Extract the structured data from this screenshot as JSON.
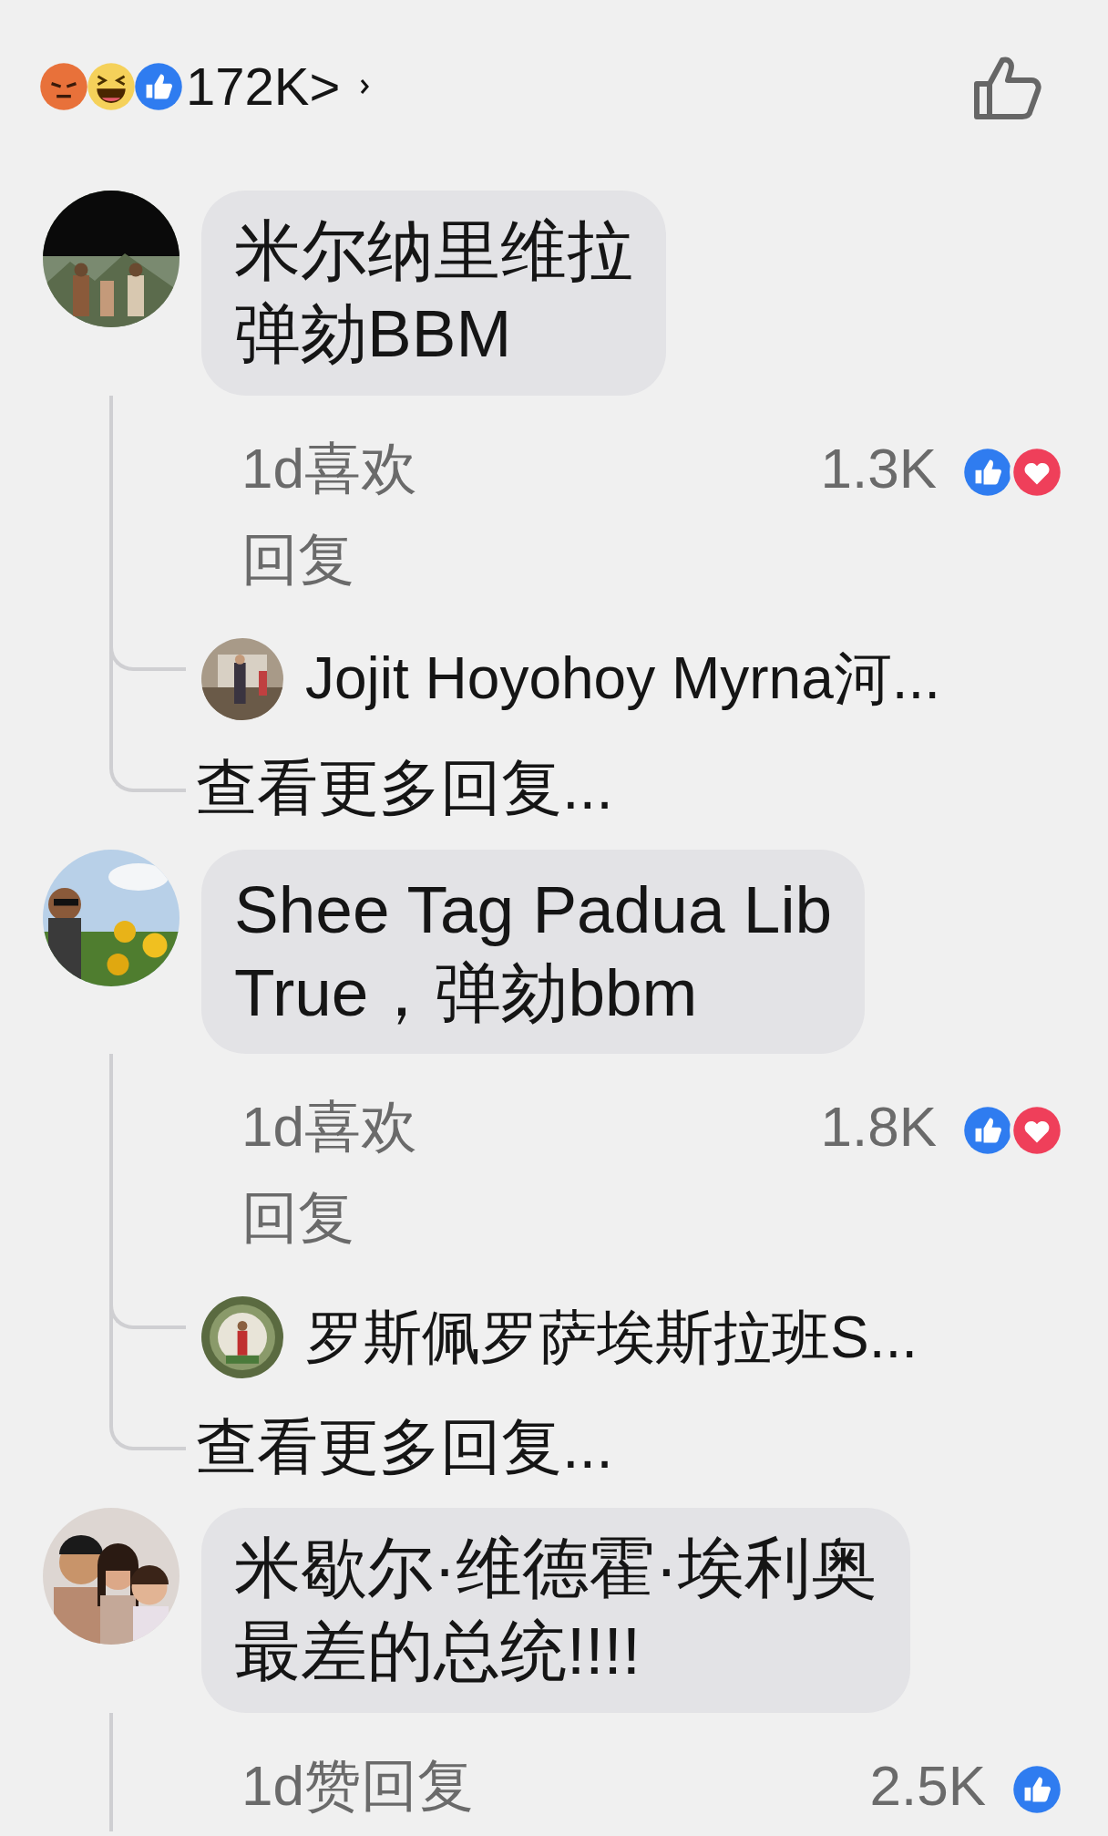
{
  "reactions_bar": {
    "reactions": [
      {
        "kind": "angry"
      },
      {
        "kind": "haha"
      },
      {
        "kind": "like"
      }
    ],
    "count": "172K>"
  },
  "comments": [
    {
      "lines": [
        "米尔纳里维拉",
        "弹劾BBM"
      ],
      "time": "1d",
      "like": "喜欢",
      "reply": "回复",
      "count": "1.3K",
      "reactions": [
        {
          "kind": "like"
        },
        {
          "kind": "love"
        }
      ],
      "reply_preview": {
        "text": "Jojit Hoyohoy Myrna河..."
      },
      "more_replies": "查看更多回复..."
    },
    {
      "lines": [
        "Shee Tag Padua Lib",
        "True，弹劾bbm"
      ],
      "time": "1d",
      "like": "喜欢",
      "reply": "回复",
      "count": "1.8K",
      "reactions": [
        {
          "kind": "like"
        },
        {
          "kind": "love"
        }
      ],
      "reply_preview": {
        "text": "罗斯佩罗萨埃斯拉班S..."
      },
      "more_replies": "查看更多回复..."
    },
    {
      "lines": [
        "米歇尔·维德霍·埃利奥",
        "最差的总统!!!!"
      ],
      "time": "1d",
      "like": "赞",
      "reply": "回复",
      "count": "2.5K",
      "reactions": [
        {
          "kind": "like"
        }
      ]
    }
  ]
}
